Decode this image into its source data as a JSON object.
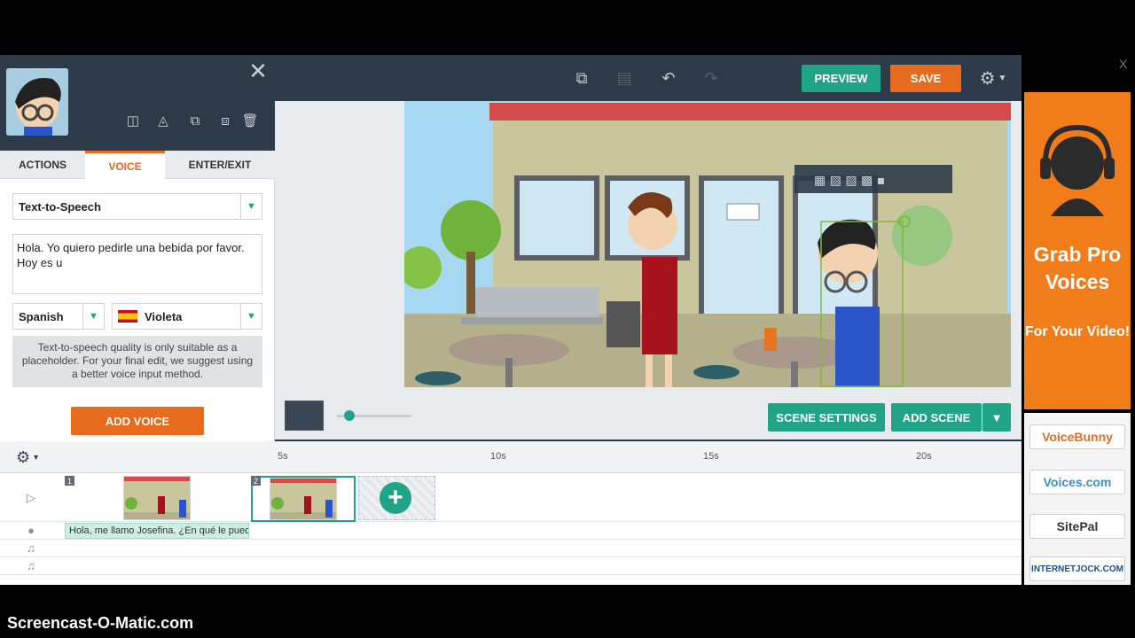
{
  "toolbar": {
    "preview_label": "PREVIEW",
    "save_label": "SAVE",
    "icons": [
      "copy-icon",
      "paste-icon",
      "undo-icon",
      "redo-icon",
      "gear-icon"
    ]
  },
  "panel": {
    "tabs": [
      {
        "label": "ACTIONS",
        "active": false
      },
      {
        "label": "VOICE",
        "active": true
      },
      {
        "label": "ENTER/EXIT",
        "active": false
      }
    ],
    "voice_method": "Text-to-Speech",
    "tts_text": "Hola.  Yo quiero pedirle una bebida por favor. Hoy es u",
    "language": "Spanish",
    "voice_name": "Violeta",
    "note": "Text-to-speech quality is only suitable as a placeholder. For your final edit, we suggest using a better voice input method.",
    "add_voice_label": "ADD VOICE"
  },
  "scene_controls": {
    "scene_settings_label": "SCENE SETTINGS",
    "add_scene_label": "ADD SCENE"
  },
  "timeline": {
    "ticks": [
      "5s",
      "10s",
      "15s",
      "20s"
    ],
    "scene_numbers": [
      "1",
      "2"
    ],
    "voice_clip_text": "Hola, me llamo Josefina. ¿En qué le puedo"
  },
  "ad": {
    "headline": "Grab Pro Voices",
    "subline": "For Your Video!",
    "logos": [
      "VoiceBunny",
      "Voices.com",
      "SitePal",
      "INTERNETJOCK.COM"
    ],
    "close": "X"
  },
  "caption": "Screencast-O-Matic.com",
  "colors": {
    "accent_green": "#1fa487",
    "accent_orange": "#e66b1c",
    "toolbar_dark": "#2d3a48"
  }
}
